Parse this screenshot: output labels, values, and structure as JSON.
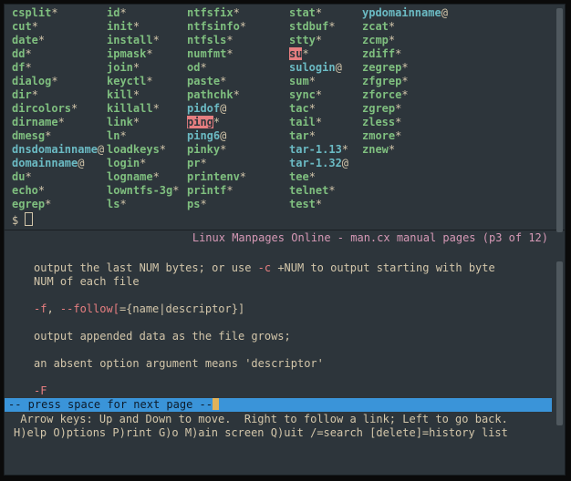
{
  "listing": {
    "columns": [
      [
        {
          "name": "csplit",
          "cls": "exe",
          "suf": "*"
        },
        {
          "name": "cut",
          "cls": "exe",
          "suf": "*"
        },
        {
          "name": "date",
          "cls": "exe",
          "suf": "*"
        },
        {
          "name": "dd",
          "cls": "exe",
          "suf": "*"
        },
        {
          "name": "df",
          "cls": "exe",
          "suf": "*"
        },
        {
          "name": "dialog",
          "cls": "exe",
          "suf": "*"
        },
        {
          "name": "dir",
          "cls": "exe",
          "suf": "*"
        },
        {
          "name": "dircolors",
          "cls": "exe",
          "suf": "*"
        },
        {
          "name": "dirname",
          "cls": "exe",
          "suf": "*"
        },
        {
          "name": "dmesg",
          "cls": "exe",
          "suf": "*"
        },
        {
          "name": "dnsdomainname",
          "cls": "syml",
          "suf": "@"
        },
        {
          "name": "domainname",
          "cls": "syml",
          "suf": "@"
        },
        {
          "name": "du",
          "cls": "exe",
          "suf": "*"
        },
        {
          "name": "echo",
          "cls": "exe",
          "suf": "*"
        },
        {
          "name": "egrep",
          "cls": "exe",
          "suf": "*"
        }
      ],
      [
        {
          "name": "id",
          "cls": "exe",
          "suf": "*"
        },
        {
          "name": "init",
          "cls": "exe",
          "suf": "*"
        },
        {
          "name": "install",
          "cls": "exe",
          "suf": "*"
        },
        {
          "name": "ipmask",
          "cls": "exe",
          "suf": "*"
        },
        {
          "name": "join",
          "cls": "exe",
          "suf": "*"
        },
        {
          "name": "keyctl",
          "cls": "exe",
          "suf": "*"
        },
        {
          "name": "kill",
          "cls": "exe",
          "suf": "*"
        },
        {
          "name": "killall",
          "cls": "exe",
          "suf": "*"
        },
        {
          "name": "link",
          "cls": "exe",
          "suf": "*"
        },
        {
          "name": "ln",
          "cls": "exe",
          "suf": "*"
        },
        {
          "name": "loadkeys",
          "cls": "exe",
          "suf": "*"
        },
        {
          "name": "login",
          "cls": "exe",
          "suf": "*"
        },
        {
          "name": "logname",
          "cls": "exe",
          "suf": "*"
        },
        {
          "name": "lowntfs-3g",
          "cls": "exe",
          "suf": "*"
        },
        {
          "name": "ls",
          "cls": "exe",
          "suf": "*"
        }
      ],
      [
        {
          "name": "ntfsfix",
          "cls": "exe",
          "suf": "*"
        },
        {
          "name": "ntfsinfo",
          "cls": "exe",
          "suf": "*"
        },
        {
          "name": "ntfsls",
          "cls": "exe",
          "suf": "*"
        },
        {
          "name": "numfmt",
          "cls": "exe",
          "suf": "*"
        },
        {
          "name": "od",
          "cls": "exe",
          "suf": "*"
        },
        {
          "name": "paste",
          "cls": "exe",
          "suf": "*"
        },
        {
          "name": "pathchk",
          "cls": "exe",
          "suf": "*"
        },
        {
          "name": "pidof",
          "cls": "syml",
          "suf": "@"
        },
        {
          "name": "ping",
          "cls": "suid",
          "suf": "*"
        },
        {
          "name": "ping6",
          "cls": "syml",
          "suf": "@"
        },
        {
          "name": "pinky",
          "cls": "exe",
          "suf": "*"
        },
        {
          "name": "pr",
          "cls": "exe",
          "suf": "*"
        },
        {
          "name": "printenv",
          "cls": "exe",
          "suf": "*"
        },
        {
          "name": "printf",
          "cls": "exe",
          "suf": "*"
        },
        {
          "name": "ps",
          "cls": "exe",
          "suf": "*"
        }
      ],
      [
        {
          "name": "stat",
          "cls": "exe",
          "suf": "*"
        },
        {
          "name": "stdbuf",
          "cls": "exe",
          "suf": "*"
        },
        {
          "name": "stty",
          "cls": "exe",
          "suf": "*"
        },
        {
          "name": "su",
          "cls": "suid",
          "suf": "*"
        },
        {
          "name": "sulogin",
          "cls": "syml",
          "suf": "@"
        },
        {
          "name": "sum",
          "cls": "exe",
          "suf": "*"
        },
        {
          "name": "sync",
          "cls": "exe",
          "suf": "*"
        },
        {
          "name": "tac",
          "cls": "exe",
          "suf": "*"
        },
        {
          "name": "tail",
          "cls": "exe",
          "suf": "*"
        },
        {
          "name": "tar",
          "cls": "exe",
          "suf": "*"
        },
        {
          "name": "tar-1.13",
          "cls": "syml",
          "suf": "*"
        },
        {
          "name": "tar-1.32",
          "cls": "syml",
          "suf": "@"
        },
        {
          "name": "tee",
          "cls": "exe",
          "suf": "*"
        },
        {
          "name": "telnet",
          "cls": "exe",
          "suf": "*"
        },
        {
          "name": "test",
          "cls": "exe",
          "suf": "*"
        }
      ],
      [
        {
          "name": "ypdomainname",
          "cls": "syml",
          "suf": "@"
        },
        {
          "name": "zcat",
          "cls": "exe",
          "suf": "*"
        },
        {
          "name": "zcmp",
          "cls": "exe",
          "suf": "*"
        },
        {
          "name": "zdiff",
          "cls": "exe",
          "suf": "*"
        },
        {
          "name": "zegrep",
          "cls": "exe",
          "suf": "*"
        },
        {
          "name": "zfgrep",
          "cls": "exe",
          "suf": "*"
        },
        {
          "name": "zforce",
          "cls": "exe",
          "suf": "*"
        },
        {
          "name": "zgrep",
          "cls": "exe",
          "suf": "*"
        },
        {
          "name": "zless",
          "cls": "exe",
          "suf": "*"
        },
        {
          "name": "zmore",
          "cls": "exe",
          "suf": "*"
        },
        {
          "name": "znew",
          "cls": "exe",
          "suf": "*"
        }
      ]
    ]
  },
  "prompt": {
    "symbol": "$"
  },
  "pager": {
    "title": "Linux Manpages Online - man.cx manual pages (p3 of 12)",
    "para1a": "output the last NUM bytes; or use ",
    "para1_opt": "-c",
    "para1b": " +NUM to output starting with byte",
    "para1c": "NUM of each file",
    "opt_f_short": "-f",
    "opt_sep": ", ",
    "opt_f_long": "--follow[",
    "opt_f_tail": "={name|descriptor}]",
    "para2": "output appended data as the file grows;",
    "para3": "an absent option argument means 'descriptor'",
    "opt_F": "-F",
    "status": "-- press space for next page --",
    "help1": " Arrow keys: Up and Down to move.  Right to follow a link; Left to go back.",
    "help2": "H)elp O)ptions P)rint G)o M)ain screen Q)uit /=search [delete]=history list"
  }
}
